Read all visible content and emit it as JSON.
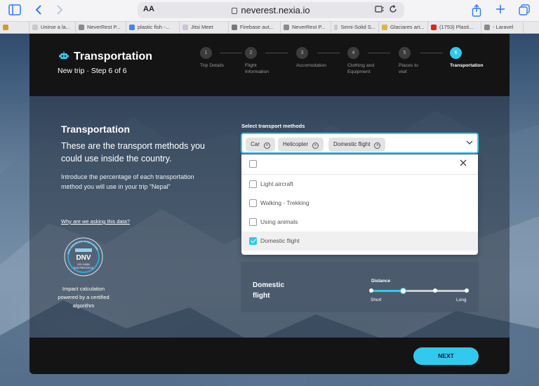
{
  "browser": {
    "text_size_label": "AA",
    "url": "neverest.nexia.io",
    "tabs": [
      {
        "label": "",
        "fav": "#d59a2c"
      },
      {
        "label": "Unirse a la...",
        "fav": "#c9c9c9"
      },
      {
        "label": "NeverRest P...",
        "fav": "#8a8a8a"
      },
      {
        "label": "plastic fish -...",
        "fav": "#4285f4"
      },
      {
        "label": "Jitsi Meet",
        "fav": "#d0c0d8"
      },
      {
        "label": "Firebase aut...",
        "fav": "#777"
      },
      {
        "label": "NeverRest P...",
        "fav": "#8a8a8a"
      },
      {
        "label": "Semi-Solid S...",
        "fav": "#c9c9c9"
      },
      {
        "label": "Glaciares art...",
        "fav": "#e3b341"
      },
      {
        "label": "(1753) Plasti...",
        "fav": "#e62117"
      },
      {
        "label": "- Laravel",
        "fav": "#888"
      }
    ]
  },
  "header": {
    "title": "Transportation",
    "subtitle": "New trip · Step 6 of 6",
    "steps": [
      {
        "num": "1",
        "label": "Trip Details"
      },
      {
        "num": "2",
        "label": "Flight Information"
      },
      {
        "num": "3",
        "label": "Accomodation"
      },
      {
        "num": "4",
        "label": "Clothing and Equipment"
      },
      {
        "num": "5",
        "label": "Places to visit"
      },
      {
        "num": "6",
        "label": "Transportation",
        "active": true
      }
    ]
  },
  "intro": {
    "title": "Transportation",
    "lead": "These are the transport methods you could use inside the country.",
    "description": "Introduce the percentage of each transportation method you will use in your trip “Nepal”",
    "link": "Why are we asking this data?",
    "badge_text": "DNV",
    "badge_sub1": "ISO 14064",
    "badge_sub2": "GHG PROTOCOL",
    "badge_ring": "GHG EMISSIONS VERIFICATION",
    "impact": "Impact calculation powered by a certified algorithm"
  },
  "select": {
    "label": "Select transport methods",
    "chips": [
      "Car",
      "Helicopter",
      "Domestic flight"
    ],
    "options": [
      {
        "label": "",
        "checked": false
      },
      {
        "label": "Light aircraft",
        "checked": false
      },
      {
        "label": "Walking - Trekking",
        "checked": false
      },
      {
        "label": "Using animals",
        "checked": false
      },
      {
        "label": "Domestic flight",
        "checked": true
      }
    ]
  },
  "transport_item": {
    "name": "Domestic flight",
    "distance_label": "Distance",
    "min_label": "Short",
    "max_label": "Long",
    "level": 0.33
  },
  "footer": {
    "next_label": "NEXT"
  },
  "colors": {
    "accent": "#31c9ee",
    "dark": "#141414"
  }
}
